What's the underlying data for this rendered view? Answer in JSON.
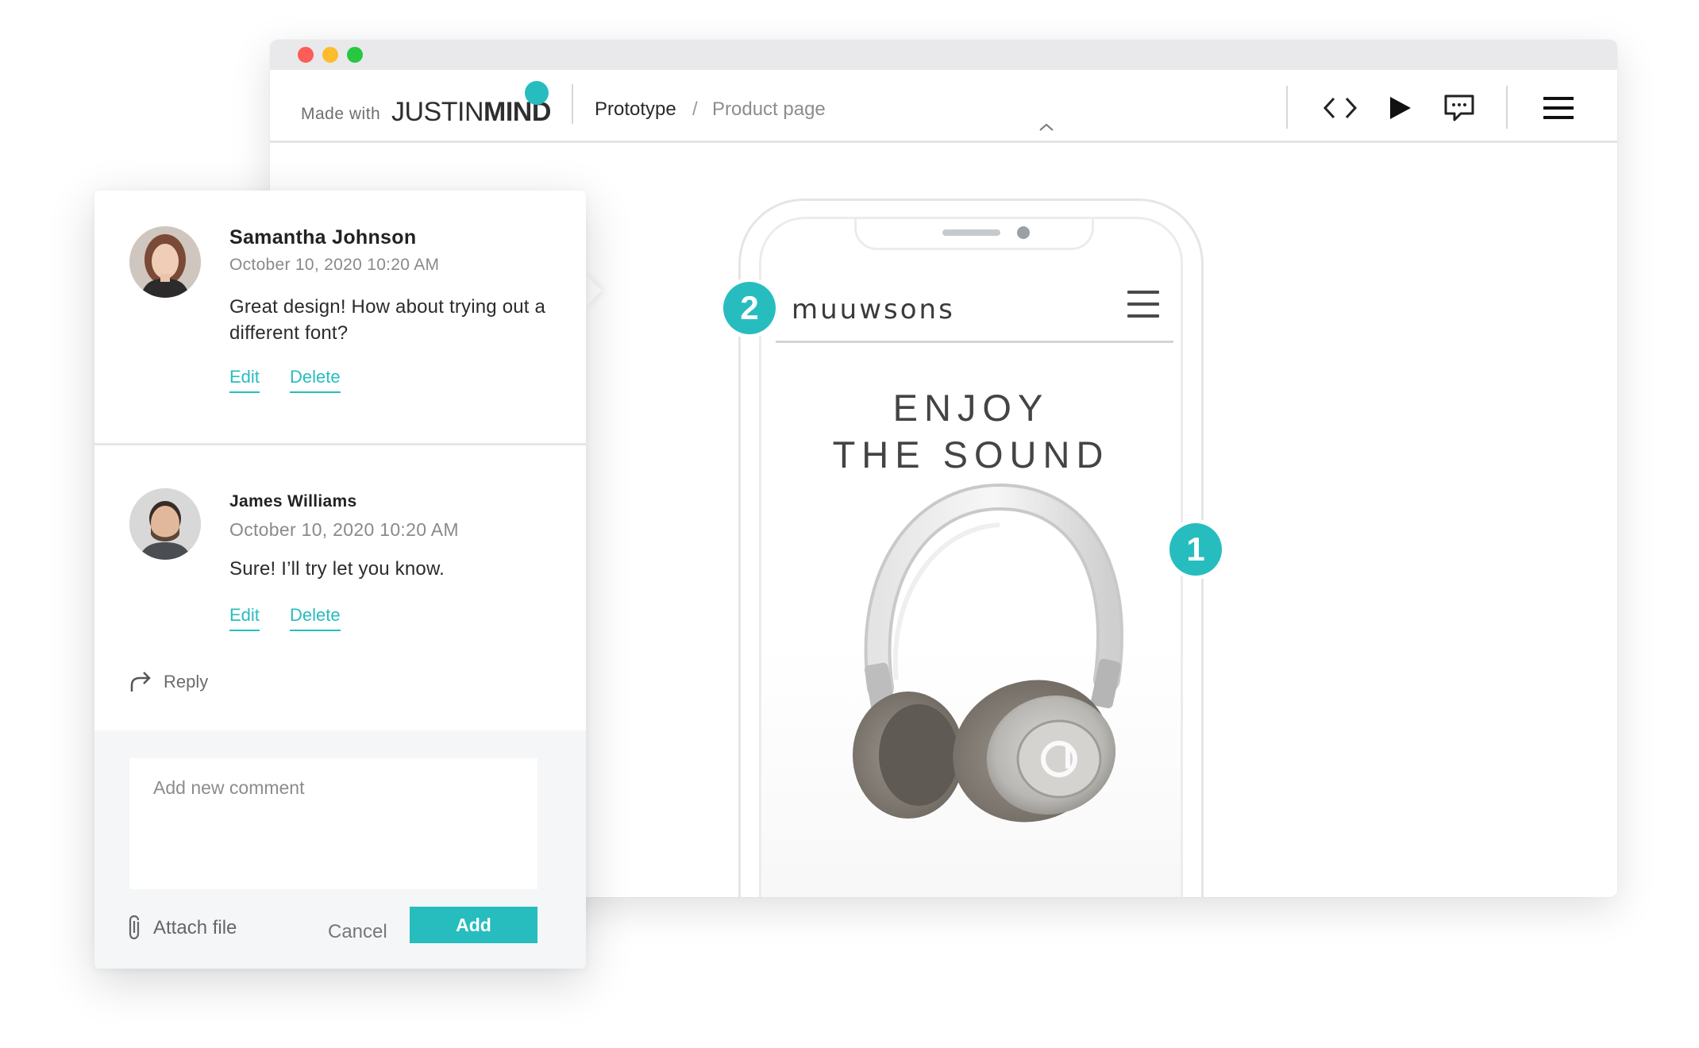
{
  "toolbar": {
    "made_with": "Made with",
    "logo_light": "JUSTIN",
    "logo_bold": "MIND",
    "breadcrumb": {
      "root": "Prototype",
      "separator": "/",
      "current": "Product page"
    },
    "icons": [
      "code-icon",
      "play-icon",
      "comment-icon",
      "menu-icon"
    ]
  },
  "prototype": {
    "brand": "muuwsons",
    "hero_line1": "ENJOY",
    "hero_line2": "THE SOUND",
    "badges": [
      "1",
      "2"
    ]
  },
  "comments": [
    {
      "author": "Samantha Johnson",
      "date": "October 10, 2020 10:20 AM",
      "text": "Great design! How about trying out a different font?",
      "edit": "Edit",
      "delete": "Delete"
    },
    {
      "author": "James Williams",
      "date": "October 10, 2020 10:20 AM",
      "text": "Sure! I’ll try let you know.",
      "edit": "Edit",
      "delete": "Delete"
    }
  ],
  "reply_label": "Reply",
  "composer": {
    "placeholder": "Add new comment",
    "attach_label": "Attach file",
    "cancel_label": "Cancel",
    "add_label": "Add"
  },
  "colors": {
    "accent": "#27bdbf",
    "traffic_red": "#fc5d57",
    "traffic_yellow": "#fdbc2e",
    "traffic_green": "#27c840"
  }
}
